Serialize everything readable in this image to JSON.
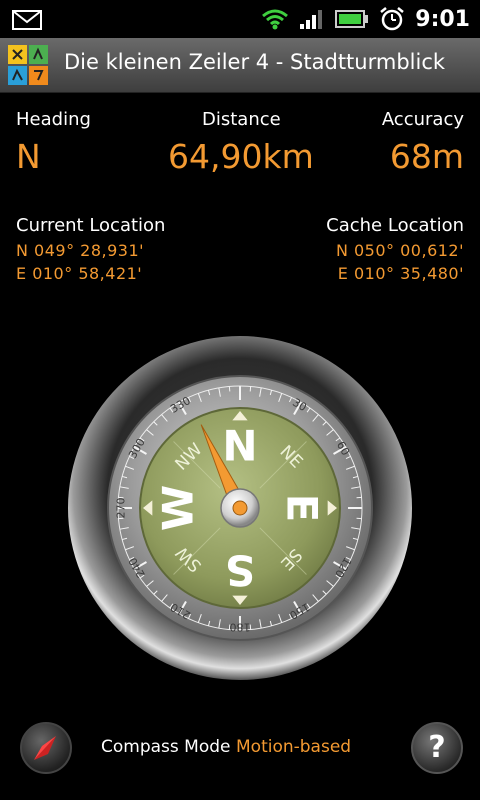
{
  "status": {
    "time": "9:01"
  },
  "app": {
    "title": "Die kleinen Zeiler 4 - Stadtturmblick"
  },
  "metrics": {
    "heading_label": "Heading",
    "heading_value": "N",
    "distance_label": "Distance",
    "distance_value": "64,90km",
    "accuracy_label": "Accuracy",
    "accuracy_value": "68m"
  },
  "current_location": {
    "label": "Current Location",
    "lat": "N  049°  28,931'",
    "lon": "E  010°  58,421'"
  },
  "cache_location": {
    "label": "Cache Location",
    "lat": "N  050°  00,612'",
    "lon": "E  010°  35,480'"
  },
  "compass": {
    "cardinals": [
      "N",
      "E",
      "S",
      "W"
    ],
    "intercardinals": [
      "NE",
      "SE",
      "SW",
      "NW"
    ],
    "degree_labels": [
      "330",
      "30",
      "60",
      "120",
      "150",
      "180",
      "210",
      "240",
      "270",
      "300"
    ],
    "needle_bearing_deg": -25,
    "accent": "#f39a32",
    "dial_green": "#9aa86a"
  },
  "footer": {
    "compass_mode_label": "Compass Mode",
    "compass_mode_value": "Motion-based",
    "help_glyph": "?"
  },
  "colors": {
    "accent": "#f39a32",
    "background": "#000000"
  }
}
